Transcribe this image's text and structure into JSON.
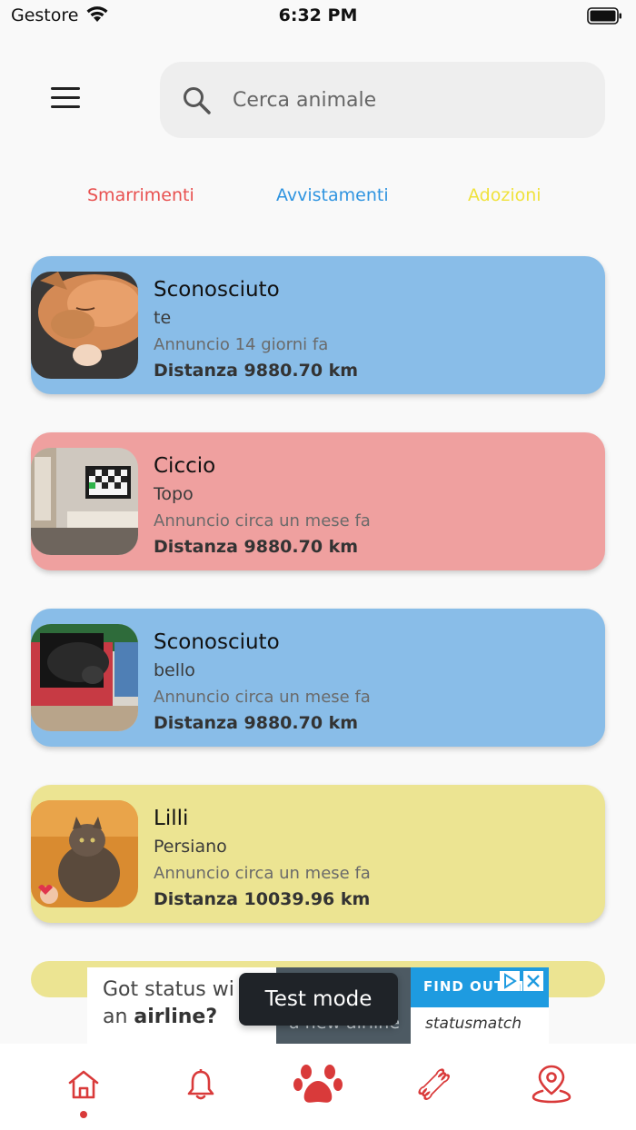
{
  "status_bar": {
    "carrier": "Gestore",
    "time": "6:32 PM"
  },
  "search": {
    "placeholder": "Cerca animale"
  },
  "tabs": [
    {
      "label": "Smarrimenti",
      "color": "#e8504f"
    },
    {
      "label": "Avvistamenti",
      "color": "#2f94e0"
    },
    {
      "label": "Adozioni",
      "color": "#f0e23c"
    }
  ],
  "cards": [
    {
      "name": "Sconosciuto",
      "breed": "te",
      "date": "Annuncio 14 giorni fa",
      "distance": "Distanza 9880.70 km",
      "color": "#89bde8"
    },
    {
      "name": "Ciccio",
      "breed": "Topo",
      "date": "Annuncio circa un mese fa",
      "distance": "Distanza 9880.70 km",
      "color": "#efa09f"
    },
    {
      "name": "Sconosciuto",
      "breed": "bello",
      "date": "Annuncio circa un mese fa",
      "distance": "Distanza 9880.70 km",
      "color": "#89bde8"
    },
    {
      "name": "Lilli",
      "breed": "Persiano",
      "date": "Annuncio circa un mese fa",
      "distance": "Distanza 10039.96 km",
      "color": "#ece492"
    }
  ],
  "ad": {
    "text_line1": "Got status wi",
    "text_line2_prefix": "an ",
    "text_line2_bold": "airline?",
    "image_text": "a new airline",
    "cta": "FIND OUT M",
    "brand": "statusmatch"
  },
  "toast": "Test mode",
  "nav": {
    "accent": "#d93a3a",
    "items": [
      "home-icon",
      "bell-icon",
      "paw-icon",
      "bone-icon",
      "map-pin-icon"
    ]
  }
}
